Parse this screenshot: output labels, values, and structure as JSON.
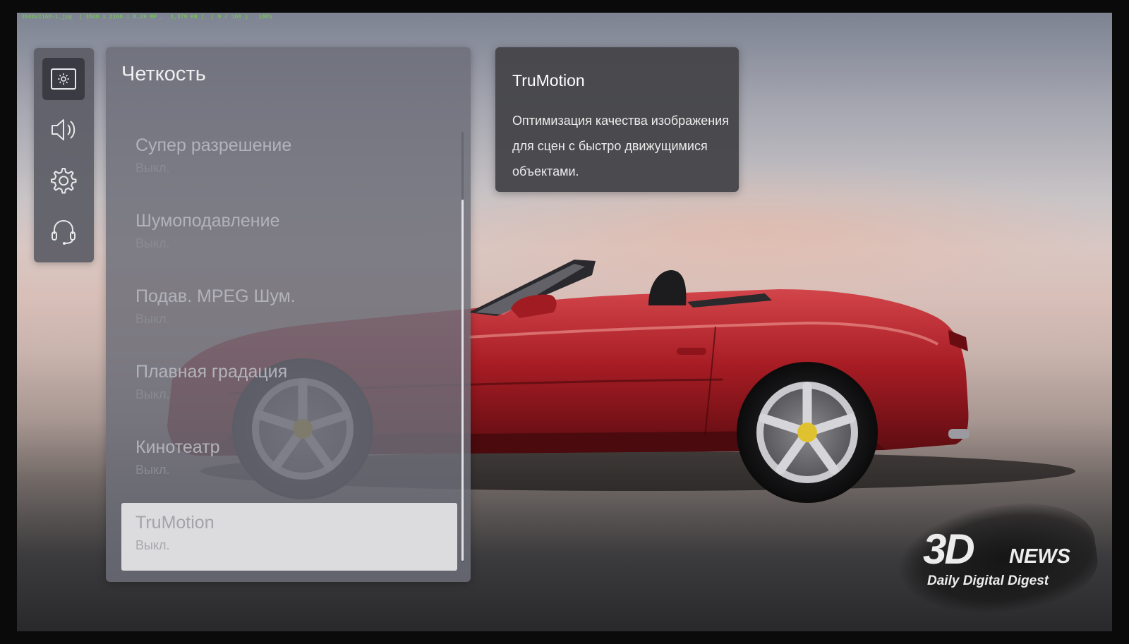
{
  "status_line": "3840x2160-1.jpg  ( 3840 x 2160 = 8.29 MP ,  2,379 KB )  ( 9 / 100 )   100%",
  "sidebar": {
    "items": [
      {
        "icon": "picture-icon",
        "active": true
      },
      {
        "icon": "speaker-icon",
        "active": false
      },
      {
        "icon": "gear-icon",
        "active": false
      },
      {
        "icon": "headset-support-icon",
        "active": false
      }
    ]
  },
  "panel": {
    "title": "Четкость",
    "items": [
      {
        "label": "Супер разрешение",
        "value": "Выкл."
      },
      {
        "label": "Шумоподавление",
        "value": "Выкл."
      },
      {
        "label": "Подав. MPEG Шум.",
        "value": "Выкл."
      },
      {
        "label": "Плавная градация",
        "value": "Выкл."
      },
      {
        "label": "Кинотеатр",
        "value": "Выкл."
      },
      {
        "label": "TruMotion",
        "value": "Выкл.",
        "selected": true
      }
    ]
  },
  "info": {
    "title": "TruMotion",
    "text": "Оптимизация качества изображения для сцен с быстро движущимися объектами."
  },
  "watermark": {
    "brand_3d": "3D",
    "brand_news": "NEWS",
    "tagline": "Daily Digital Digest"
  },
  "colors": {
    "car_red": "#b0222a",
    "panel_bg": "#6c6e78",
    "info_bg": "#46464a",
    "selected_bg": "#dcdcdf",
    "status_green": "#74d04a"
  }
}
